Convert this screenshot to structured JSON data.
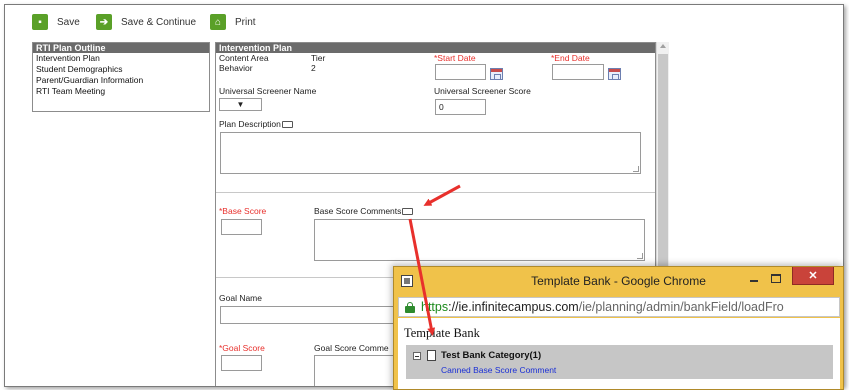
{
  "toolbar": {
    "save_label": "Save",
    "save_continue_label": "Save & Continue",
    "print_label": "Print"
  },
  "outline": {
    "header": "RTI Plan Outline",
    "items": [
      {
        "label": "Intervention Plan"
      },
      {
        "label": "Student Demographics"
      },
      {
        "label": "Parent/Guardian Information"
      },
      {
        "label": "RTI Team Meeting"
      }
    ]
  },
  "plan": {
    "header": "Intervention Plan",
    "content_area_label": "Content Area",
    "content_area_value": "Behavior",
    "tier_label": "Tier",
    "tier_value": "2",
    "start_date_label": "*Start Date",
    "end_date_label": "*End Date",
    "screener_name_label": "Universal Screener Name",
    "screener_score_label": "Universal Screener Score",
    "screener_score_value": "0",
    "screener_select_value": "▼",
    "plan_description_label": "Plan Description",
    "base_score_label": "*Base Score",
    "base_score_comments_label": "Base Score Comments",
    "goal_name_label": "Goal Name",
    "goal_score_label": "*Goal Score",
    "goal_score_comments_label": "Goal Score Comme"
  },
  "popup": {
    "title": "Template Bank - Google Chrome",
    "close_label": "✕",
    "url_https": "https",
    "url_host": "://ie.infinitecampus.com",
    "url_path": "/ie/planning/admin/bankField/loadFro",
    "bank_title": "Template Bank",
    "category_label": "Test Bank Category(1)",
    "comment_link": "Canned Base Score Comment"
  },
  "colors": {
    "accent_green": "#5aa028",
    "required_red": "#e8302c",
    "header_gray": "#6b6b6b",
    "popup_frame": "#f0c24a",
    "annotation_red": "#e8302c",
    "link_blue": "#1a2fd6"
  },
  "icons": {
    "save": "floppy-icon",
    "save_continue": "arrow-right-icon",
    "print": "printer-icon",
    "calendar": "calendar-icon",
    "note": "note-icon",
    "lock": "lock-icon"
  }
}
